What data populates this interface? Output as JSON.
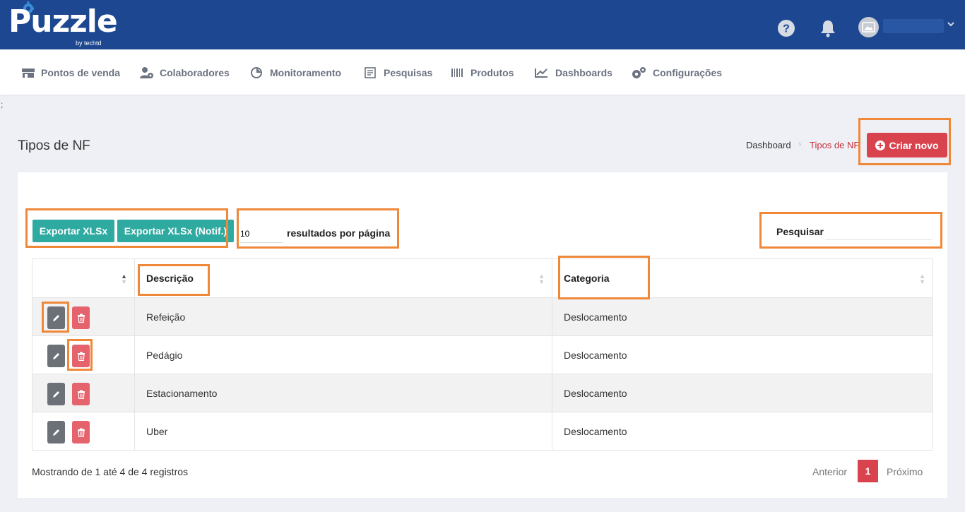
{
  "app": {
    "logo_text": "Puzzle",
    "logo_sub": "by techtd"
  },
  "header_icons": [
    "help-icon",
    "bell-icon",
    "avatar",
    "chevron-down-icon"
  ],
  "nav": {
    "items": [
      {
        "label": "Pontos de venda",
        "icon": "store-icon"
      },
      {
        "label": "Colaboradores",
        "icon": "users-icon"
      },
      {
        "label": "Monitoramento",
        "icon": "monitor-icon"
      },
      {
        "label": "Pesquisas",
        "icon": "survey-icon"
      },
      {
        "label": "Produtos",
        "icon": "barcode-icon"
      },
      {
        "label": "Dashboards",
        "icon": "chart-icon"
      },
      {
        "label": "Configurações",
        "icon": "gears-icon"
      }
    ]
  },
  "stray_text": ";",
  "page": {
    "title": "Tipos de NF",
    "breadcrumb": [
      "Dashboard",
      "Tipos de NF"
    ],
    "create_button": "Criar novo"
  },
  "toolbar": {
    "export_xlsx": "Exportar XLSx",
    "export_xlsx_notif": "Exportar XLSx (Notif.)",
    "page_length": "10",
    "page_length_label": "resultados por página",
    "search_label": "Pesquisar",
    "search_value": ""
  },
  "table": {
    "columns": [
      "",
      "Descrição",
      "Categoria"
    ],
    "rows": [
      {
        "descricao": "Refeição",
        "categoria": "Deslocamento"
      },
      {
        "descricao": "Pedágio",
        "categoria": "Deslocamento"
      },
      {
        "descricao": "Estacionamento",
        "categoria": "Deslocamento"
      },
      {
        "descricao": "Uber",
        "categoria": "Deslocamento"
      }
    ]
  },
  "footer": {
    "info": "Mostrando de 1 até 4 de 4 registros",
    "prev": "Anterior",
    "current_page": "1",
    "next": "Próximo"
  },
  "colors": {
    "header_bg": "#1d4891",
    "accent_red": "#d9434e",
    "export_teal": "#2eaaa0",
    "highlight": "#f0883a"
  }
}
